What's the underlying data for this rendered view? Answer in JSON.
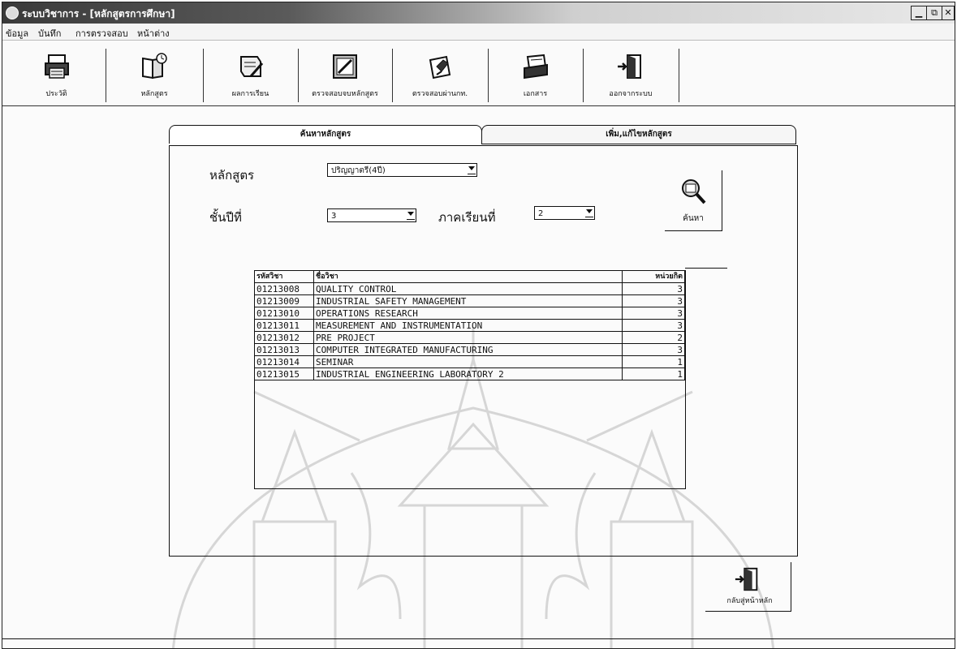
{
  "window": {
    "title": "ระบบวิชาการ - [หลักสูตรการศึกษา]",
    "controls": [
      "minimize",
      "maximize",
      "close"
    ]
  },
  "menu": {
    "items": [
      "ข้อมูล",
      "บันทึก",
      "การตรวจสอบ",
      "หน้าต่าง"
    ]
  },
  "toolbar": {
    "buttons": [
      {
        "label": "ประวัติ",
        "icon": "printer-icon"
      },
      {
        "label": "หลักสูตร",
        "icon": "book-clock-icon"
      },
      {
        "label": "ผลการเรียน",
        "icon": "scroll-pen-icon"
      },
      {
        "label": "ตรวจสอบจบหลักสูตร",
        "icon": "notepad-pencil-icon"
      },
      {
        "label": "ตรวจสอบผ่านกท.",
        "icon": "writing-hand-icon"
      },
      {
        "label": "เอกสาร",
        "icon": "paper-tray-icon"
      },
      {
        "label": "ออกจากระบบ",
        "icon": "exit-door-icon"
      }
    ]
  },
  "tabs": {
    "active": "ค้นหาหลักสูตร",
    "inactive": "เพิ่ม,แก้ไขหลักสูตร"
  },
  "form": {
    "curriculum_label": "หลักสูตร",
    "curriculum_value": "ปริญญาตรี(4ปี)",
    "year_label": "ชั้นปีที่",
    "year_value": "3",
    "semester_label": "ภาคเรียนที่",
    "semester_value": "2",
    "search_label": "ค้นหา"
  },
  "table": {
    "headers": [
      "รหัสวิชา",
      "ชื่อวิชา",
      "หน่วยกิต"
    ],
    "rows": [
      [
        "01213008",
        "QUALITY CONTROL",
        "3"
      ],
      [
        "01213009",
        "INDUSTRIAL SAFETY MANAGEMENT",
        "3"
      ],
      [
        "01213010",
        "OPERATIONS RESEARCH",
        "3"
      ],
      [
        "01213011",
        "MEASUREMENT AND INSTRUMENTATION",
        "3"
      ],
      [
        "01213012",
        "PRE PROJECT",
        "2"
      ],
      [
        "01213013",
        "COMPUTER INTEGRATED MANUFACTURING",
        "3"
      ],
      [
        "01213014",
        "SEMINAR",
        "1"
      ],
      [
        "01213015",
        "INDUSTRIAL ENGINEERING LABORATORY 2",
        "1"
      ]
    ]
  },
  "footer": {
    "home_label": "กลับสู่หน้าหลัก"
  }
}
